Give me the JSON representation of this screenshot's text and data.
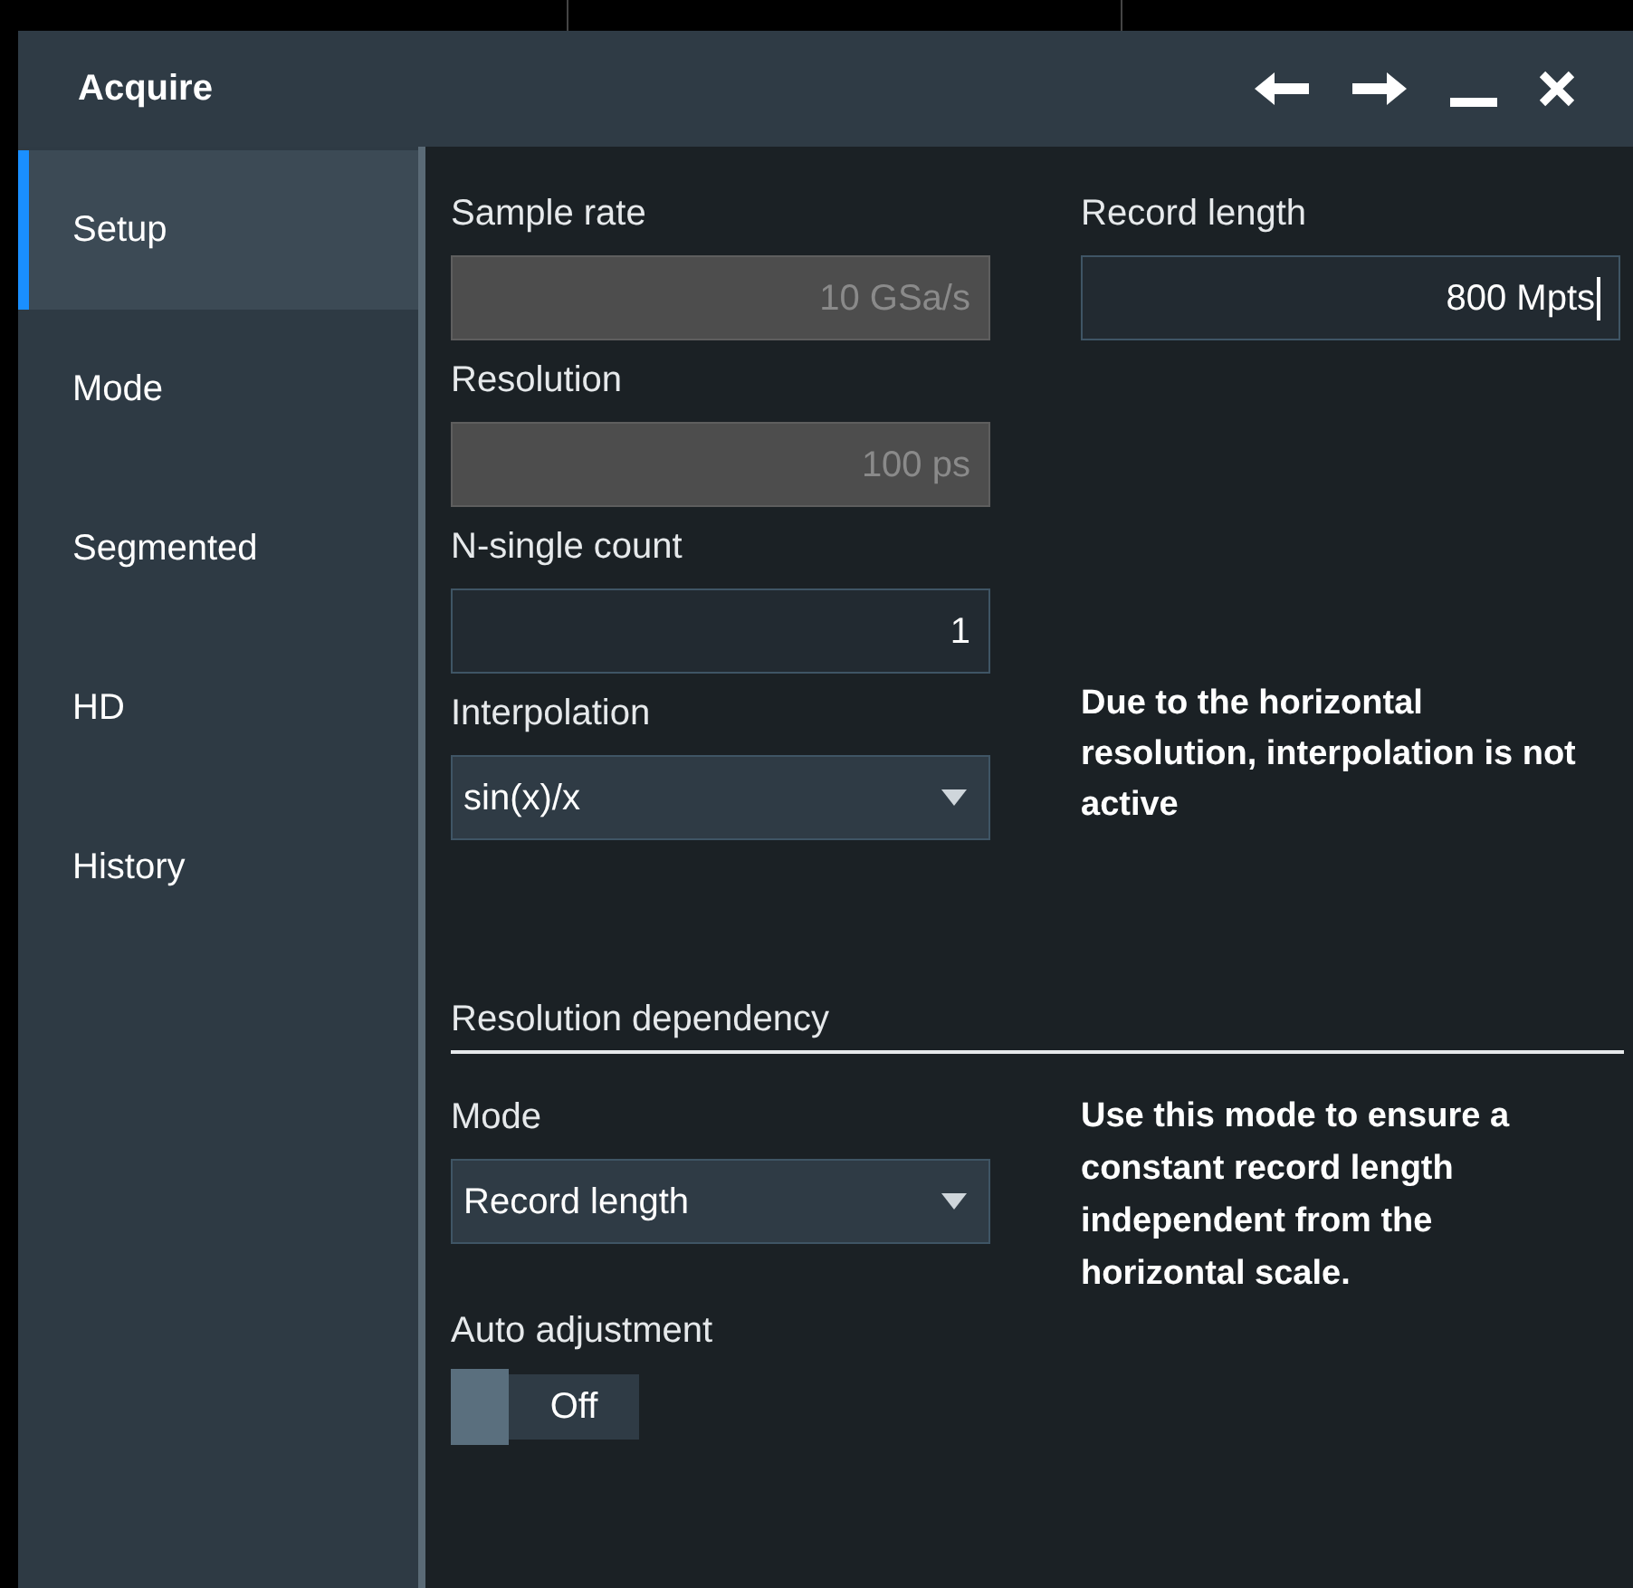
{
  "window": {
    "title": "Acquire"
  },
  "sidebar": {
    "items": [
      {
        "label": "Setup",
        "selected": true
      },
      {
        "label": "Mode",
        "selected": false
      },
      {
        "label": "Segmented",
        "selected": false
      },
      {
        "label": "HD",
        "selected": false
      },
      {
        "label": "History",
        "selected": false
      }
    ]
  },
  "field_rows": [
    [
      {
        "kind": "input",
        "label": "Sample rate",
        "value": "10 GSa/s",
        "disabled": true,
        "focused": false
      },
      {
        "kind": "input",
        "label": "Record length",
        "value": "800 Mpts",
        "disabled": false,
        "focused": true
      }
    ],
    [
      {
        "kind": "input",
        "label": "Resolution",
        "value": "100 ps",
        "disabled": true,
        "focused": false
      }
    ],
    [
      {
        "kind": "input",
        "label": "N-single count",
        "value": "1",
        "disabled": false,
        "focused": false
      }
    ],
    [
      {
        "kind": "select",
        "label": "Interpolation",
        "value": "sin(x)/x"
      },
      {
        "kind": "note",
        "text": "Due to the horizontal resolution, interpolation is not active"
      }
    ]
  ],
  "resolution_dependency": {
    "heading": "Resolution dependency",
    "mode": {
      "label": "Mode",
      "value": "Record length",
      "note": "Use this mode to ensure a constant record length independent from the horizontal scale."
    },
    "auto_adjustment": {
      "label": "Auto adjustment",
      "on": false,
      "state_text": "Off"
    }
  }
}
